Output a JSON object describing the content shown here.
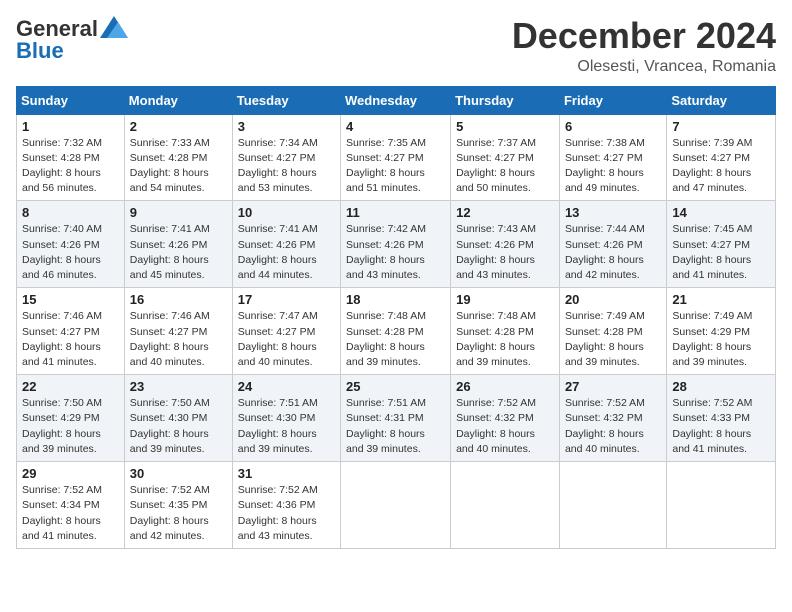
{
  "logo": {
    "general": "General",
    "blue": "Blue"
  },
  "title": "December 2024",
  "location": "Olesesti, Vrancea, Romania",
  "days_of_week": [
    "Sunday",
    "Monday",
    "Tuesday",
    "Wednesday",
    "Thursday",
    "Friday",
    "Saturday"
  ],
  "weeks": [
    [
      {
        "day": "1",
        "sunrise": "7:32 AM",
        "sunset": "4:28 PM",
        "daylight": "8 hours and 56 minutes."
      },
      {
        "day": "2",
        "sunrise": "7:33 AM",
        "sunset": "4:28 PM",
        "daylight": "8 hours and 54 minutes."
      },
      {
        "day": "3",
        "sunrise": "7:34 AM",
        "sunset": "4:27 PM",
        "daylight": "8 hours and 53 minutes."
      },
      {
        "day": "4",
        "sunrise": "7:35 AM",
        "sunset": "4:27 PM",
        "daylight": "8 hours and 51 minutes."
      },
      {
        "day": "5",
        "sunrise": "7:37 AM",
        "sunset": "4:27 PM",
        "daylight": "8 hours and 50 minutes."
      },
      {
        "day": "6",
        "sunrise": "7:38 AM",
        "sunset": "4:27 PM",
        "daylight": "8 hours and 49 minutes."
      },
      {
        "day": "7",
        "sunrise": "7:39 AM",
        "sunset": "4:27 PM",
        "daylight": "8 hours and 47 minutes."
      }
    ],
    [
      {
        "day": "8",
        "sunrise": "7:40 AM",
        "sunset": "4:26 PM",
        "daylight": "8 hours and 46 minutes."
      },
      {
        "day": "9",
        "sunrise": "7:41 AM",
        "sunset": "4:26 PM",
        "daylight": "8 hours and 45 minutes."
      },
      {
        "day": "10",
        "sunrise": "7:41 AM",
        "sunset": "4:26 PM",
        "daylight": "8 hours and 44 minutes."
      },
      {
        "day": "11",
        "sunrise": "7:42 AM",
        "sunset": "4:26 PM",
        "daylight": "8 hours and 43 minutes."
      },
      {
        "day": "12",
        "sunrise": "7:43 AM",
        "sunset": "4:26 PM",
        "daylight": "8 hours and 43 minutes."
      },
      {
        "day": "13",
        "sunrise": "7:44 AM",
        "sunset": "4:26 PM",
        "daylight": "8 hours and 42 minutes."
      },
      {
        "day": "14",
        "sunrise": "7:45 AM",
        "sunset": "4:27 PM",
        "daylight": "8 hours and 41 minutes."
      }
    ],
    [
      {
        "day": "15",
        "sunrise": "7:46 AM",
        "sunset": "4:27 PM",
        "daylight": "8 hours and 41 minutes."
      },
      {
        "day": "16",
        "sunrise": "7:46 AM",
        "sunset": "4:27 PM",
        "daylight": "8 hours and 40 minutes."
      },
      {
        "day": "17",
        "sunrise": "7:47 AM",
        "sunset": "4:27 PM",
        "daylight": "8 hours and 40 minutes."
      },
      {
        "day": "18",
        "sunrise": "7:48 AM",
        "sunset": "4:28 PM",
        "daylight": "8 hours and 39 minutes."
      },
      {
        "day": "19",
        "sunrise": "7:48 AM",
        "sunset": "4:28 PM",
        "daylight": "8 hours and 39 minutes."
      },
      {
        "day": "20",
        "sunrise": "7:49 AM",
        "sunset": "4:28 PM",
        "daylight": "8 hours and 39 minutes."
      },
      {
        "day": "21",
        "sunrise": "7:49 AM",
        "sunset": "4:29 PM",
        "daylight": "8 hours and 39 minutes."
      }
    ],
    [
      {
        "day": "22",
        "sunrise": "7:50 AM",
        "sunset": "4:29 PM",
        "daylight": "8 hours and 39 minutes."
      },
      {
        "day": "23",
        "sunrise": "7:50 AM",
        "sunset": "4:30 PM",
        "daylight": "8 hours and 39 minutes."
      },
      {
        "day": "24",
        "sunrise": "7:51 AM",
        "sunset": "4:30 PM",
        "daylight": "8 hours and 39 minutes."
      },
      {
        "day": "25",
        "sunrise": "7:51 AM",
        "sunset": "4:31 PM",
        "daylight": "8 hours and 39 minutes."
      },
      {
        "day": "26",
        "sunrise": "7:52 AM",
        "sunset": "4:32 PM",
        "daylight": "8 hours and 40 minutes."
      },
      {
        "day": "27",
        "sunrise": "7:52 AM",
        "sunset": "4:32 PM",
        "daylight": "8 hours and 40 minutes."
      },
      {
        "day": "28",
        "sunrise": "7:52 AM",
        "sunset": "4:33 PM",
        "daylight": "8 hours and 41 minutes."
      }
    ],
    [
      {
        "day": "29",
        "sunrise": "7:52 AM",
        "sunset": "4:34 PM",
        "daylight": "8 hours and 41 minutes."
      },
      {
        "day": "30",
        "sunrise": "7:52 AM",
        "sunset": "4:35 PM",
        "daylight": "8 hours and 42 minutes."
      },
      {
        "day": "31",
        "sunrise": "7:52 AM",
        "sunset": "4:36 PM",
        "daylight": "8 hours and 43 minutes."
      },
      null,
      null,
      null,
      null
    ]
  ]
}
